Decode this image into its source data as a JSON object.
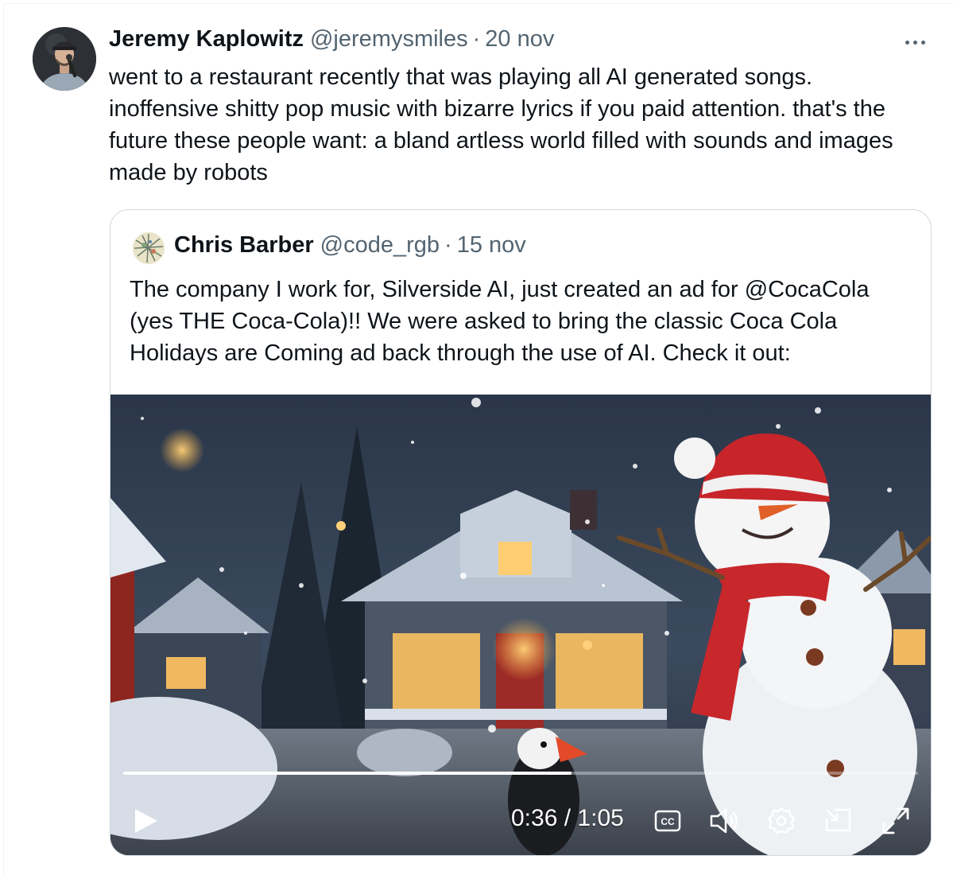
{
  "tweet": {
    "author_name": "Jeremy Kaplowitz",
    "author_handle": "@jeremysmiles",
    "separator": "·",
    "date": "20 nov",
    "text": "went to a restaurant recently that was playing all AI generated songs. inoffensive shitty pop music with bizarre lyrics if you paid attention. that's the future these people want: a bland artless world filled with sounds and images made by robots",
    "more_icon": "more-horizontal-icon"
  },
  "quoted": {
    "author_name": "Chris Barber",
    "author_handle": "@code_rgb",
    "separator": "·",
    "date": "15 nov",
    "text": "The company I work for, Silverside AI, just created an ad for @CocaCola (yes THE Coca-Cola)!! We were asked to bring the classic Coca Cola Holidays are Coming ad back through the use of AI. Check it out:"
  },
  "video": {
    "current_time": "0:36",
    "time_separator": "/",
    "duration": "1:05",
    "progress_fraction": 0.564,
    "icons": {
      "play": "play-icon",
      "captions": "closed-captions-icon",
      "volume": "volume-icon",
      "settings": "settings-gear-icon",
      "pip": "picture-in-picture-icon",
      "fullscreen": "fullscreen-icon"
    }
  }
}
